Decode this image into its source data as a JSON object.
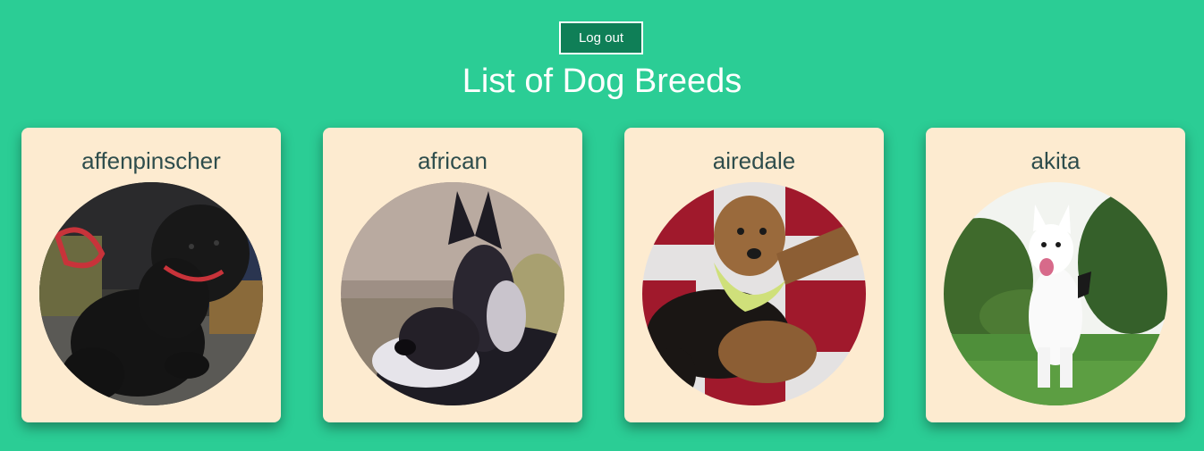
{
  "header": {
    "logout_label": "Log out",
    "title": "List of Dog Breeds"
  },
  "breeds": [
    {
      "name": "affenpinscher",
      "image": "black-affenpinscher-dog-photo"
    },
    {
      "name": "african",
      "image": "african-wild-dog-photo"
    },
    {
      "name": "airedale",
      "image": "airedale-terrier-with-bandana-photo"
    },
    {
      "name": "akita",
      "image": "white-akita-on-grass-photo"
    }
  ],
  "colors": {
    "background": "#2bcd95",
    "button": "#0f7f57",
    "card": "#fdebd0",
    "card_text": "#2e4d4c"
  }
}
